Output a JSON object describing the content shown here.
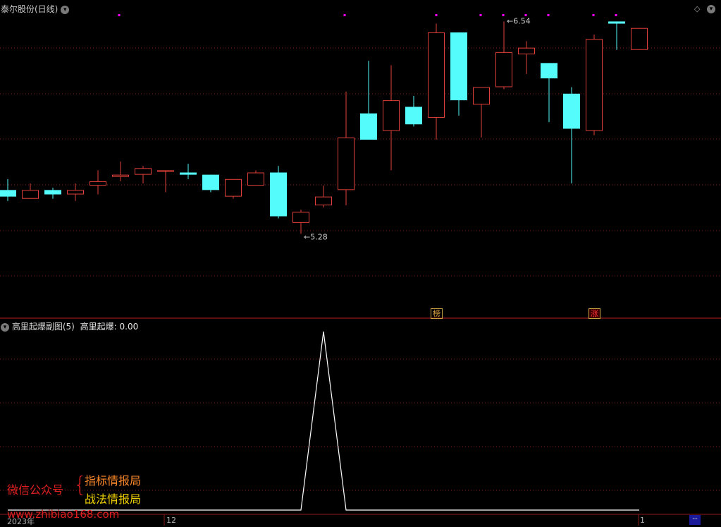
{
  "header": {
    "title": "泰尔股份(日线)",
    "dropdown_icon": "chevron-down-icon",
    "diamond_icon": "diamond-icon",
    "settings_icon": "gear-icon"
  },
  "price_panel": {
    "high_marker": "6.54",
    "low_marker": "5.28",
    "badges": [
      "榜",
      "涨"
    ]
  },
  "indicator_panel": {
    "title": "高里起爆副图(5)",
    "value_label": "高里起爆: 0.00"
  },
  "watermark": {
    "line_prefix": "微信公众号",
    "brace": "{",
    "line1": "指标情报局",
    "line2": "战法情报局",
    "url": "www.zhibiao168.com"
  },
  "date_axis": {
    "labels": [
      "2023年",
      "12",
      "1"
    ],
    "end_label": "--"
  },
  "colors": {
    "up": "#e0403a",
    "down": "#54fcfc",
    "grid": "#8a1a1a",
    "marker": "#ff00ff",
    "divider": "#c02020"
  },
  "candles": [
    {
      "o": 5.77,
      "h": 5.82,
      "l": 5.72,
      "c": 5.74
    },
    {
      "o": 5.73,
      "h": 5.8,
      "l": 5.73,
      "c": 5.77
    },
    {
      "o": 5.77,
      "h": 5.78,
      "l": 5.73,
      "c": 5.75
    },
    {
      "o": 5.75,
      "h": 5.8,
      "l": 5.72,
      "c": 5.77
    },
    {
      "o": 5.79,
      "h": 5.86,
      "l": 5.75,
      "c": 5.81
    },
    {
      "o": 5.83,
      "h": 5.9,
      "l": 5.81,
      "c": 5.84
    },
    {
      "o": 5.84,
      "h": 5.88,
      "l": 5.8,
      "c": 5.87
    },
    {
      "o": 5.86,
      "h": 5.86,
      "l": 5.76,
      "c": 5.86
    },
    {
      "o": 5.85,
      "h": 5.89,
      "l": 5.82,
      "c": 5.84
    },
    {
      "o": 5.84,
      "h": 5.84,
      "l": 5.76,
      "c": 5.77
    },
    {
      "o": 5.74,
      "h": 5.81,
      "l": 5.73,
      "c": 5.82
    },
    {
      "o": 5.79,
      "h": 5.86,
      "l": 5.79,
      "c": 5.85
    },
    {
      "o": 5.85,
      "h": 5.88,
      "l": 5.64,
      "c": 5.65
    },
    {
      "o": 5.62,
      "h": 5.68,
      "l": 5.57,
      "c": 5.67
    },
    {
      "o": 5.7,
      "h": 5.79,
      "l": 5.69,
      "c": 5.74
    },
    {
      "o": 5.77,
      "h": 6.22,
      "l": 5.7,
      "c": 6.01
    },
    {
      "o": 6.12,
      "h": 6.36,
      "l": 6.03,
      "c": 6.0
    },
    {
      "o": 6.04,
      "h": 6.34,
      "l": 5.86,
      "c": 6.18
    },
    {
      "o": 6.15,
      "h": 6.2,
      "l": 6.06,
      "c": 6.07
    },
    {
      "o": 6.1,
      "h": 6.53,
      "l": 6.0,
      "c": 6.49
    },
    {
      "o": 6.49,
      "h": 6.49,
      "l": 6.11,
      "c": 6.18
    },
    {
      "o": 6.16,
      "h": 6.21,
      "l": 6.01,
      "c": 6.24
    },
    {
      "o": 6.24,
      "h": 6.54,
      "l": 6.23,
      "c": 6.4
    },
    {
      "o": 6.39,
      "h": 6.45,
      "l": 6.3,
      "c": 6.42
    },
    {
      "o": 6.35,
      "h": 6.35,
      "l": 6.08,
      "c": 6.28
    },
    {
      "o": 6.21,
      "h": 6.24,
      "l": 5.8,
      "c": 6.05
    },
    {
      "o": 6.04,
      "h": 6.48,
      "l": 6.02,
      "c": 6.46
    },
    {
      "o": 6.54,
      "h": 6.54,
      "l": 6.41,
      "c": 6.53
    },
    {
      "o": 6.41,
      "h": 6.51,
      "l": 6.41,
      "c": 6.51
    }
  ],
  "indicator": {
    "values": [
      0,
      0,
      0,
      0,
      0,
      0,
      0,
      0,
      0,
      0,
      0,
      0,
      0,
      0,
      1,
      0,
      0,
      0,
      0,
      0,
      0,
      0,
      0,
      0,
      0,
      0,
      0,
      0,
      0
    ],
    "max": 1
  }
}
